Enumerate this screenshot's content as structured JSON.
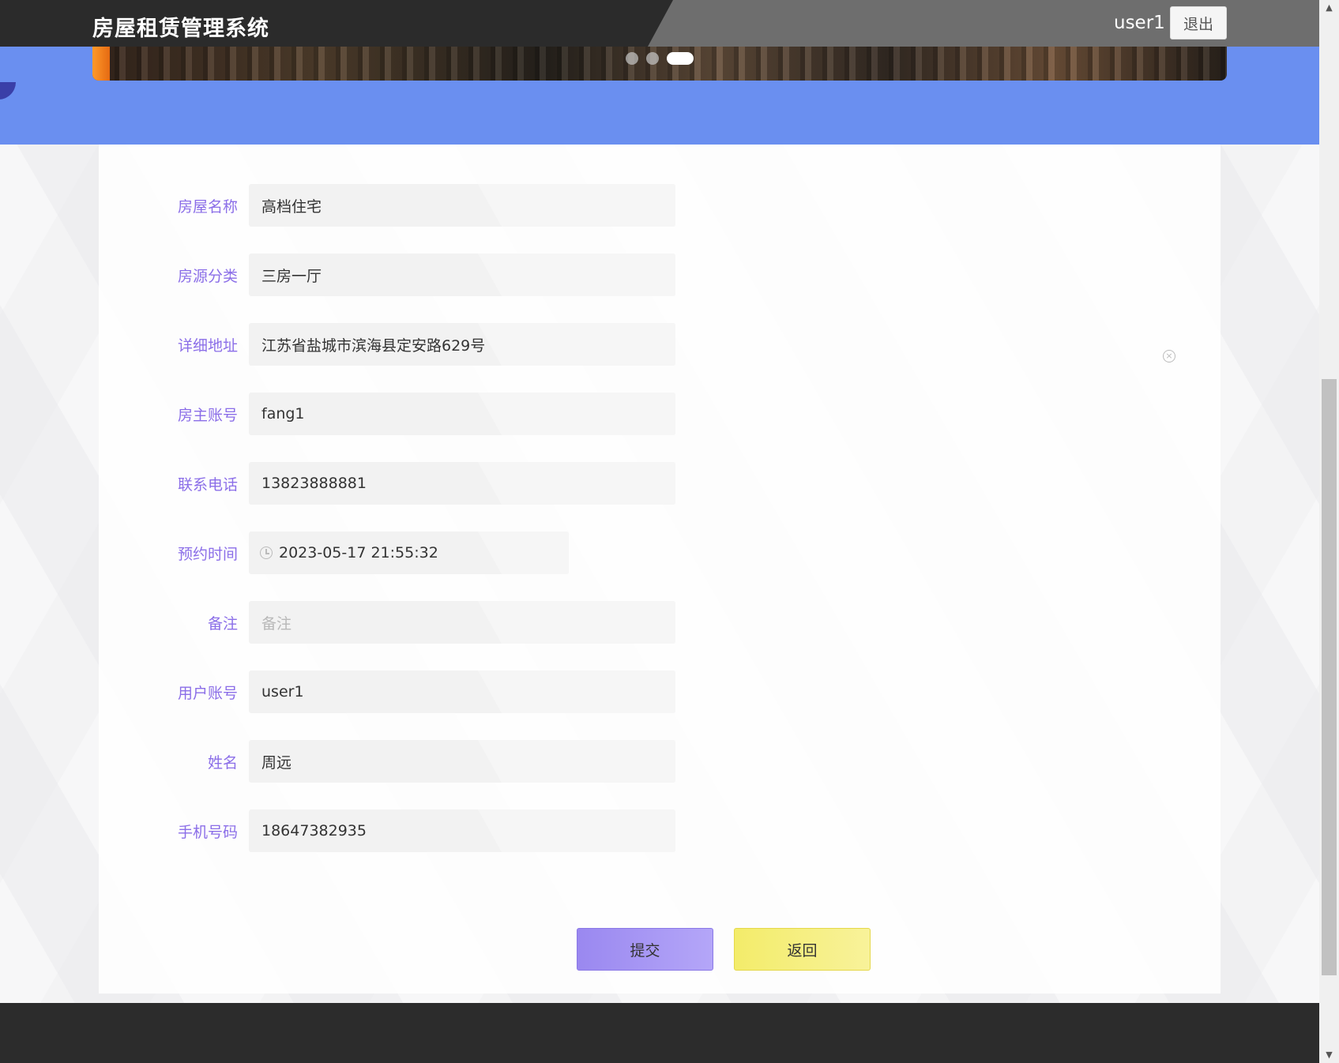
{
  "header": {
    "brand": "房屋租赁管理系统",
    "username": "user1",
    "logout_label": "退出"
  },
  "carousel": {
    "slides": 3,
    "active_index": 2
  },
  "form": {
    "fields": [
      {
        "label": "房屋名称",
        "value": "高档住宅"
      },
      {
        "label": "房源分类",
        "value": "三房一厅"
      },
      {
        "label": "详细地址",
        "value": "江苏省盐城市滨海县定安路629号"
      },
      {
        "label": "房主账号",
        "value": "fang1"
      },
      {
        "label": "联系电话",
        "value": "13823888881"
      },
      {
        "label": "预约时间",
        "value": "2023-05-17 21:55:32"
      },
      {
        "label": "备注",
        "value": "",
        "placeholder": "备注"
      },
      {
        "label": "用户账号",
        "value": "user1"
      },
      {
        "label": "姓名",
        "value": "周远"
      },
      {
        "label": "手机号码",
        "value": "18647382935"
      }
    ],
    "submit_label": "提交",
    "back_label": "返回"
  },
  "colors": {
    "accent_label": "#8b6ee8",
    "banner": "#6a8ff0",
    "submit": "#a898f4",
    "back": "#f5ef80"
  }
}
